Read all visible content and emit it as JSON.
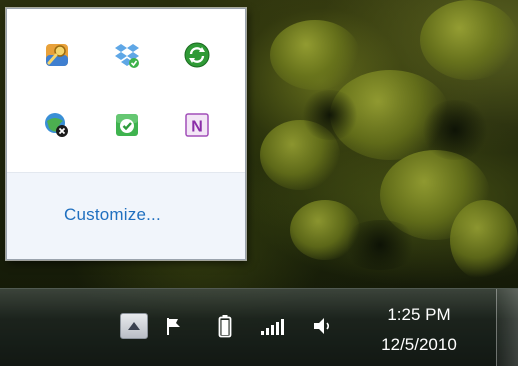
{
  "overflow_panel": {
    "icons": [
      {
        "name": "key-manager-icon"
      },
      {
        "name": "dropbox-icon"
      },
      {
        "name": "sync-icon"
      },
      {
        "name": "network-disconnected-icon"
      },
      {
        "name": "security-check-icon"
      },
      {
        "name": "onenote-icon",
        "glyph": "N"
      }
    ],
    "customize_label": "Customize..."
  },
  "taskbar": {
    "tray_icons": [
      "show-hidden-icons",
      "action-center-flag-icon",
      "battery-icon",
      "wireless-signal-icon",
      "volume-icon"
    ],
    "clock": {
      "time": "1:25 PM",
      "date": "12/5/2010"
    }
  },
  "colors": {
    "link": "#1f6fbf",
    "popup_bg": "#ffffff",
    "popup_footer": "#f1f5fb",
    "taskbar": "#1c241e"
  }
}
